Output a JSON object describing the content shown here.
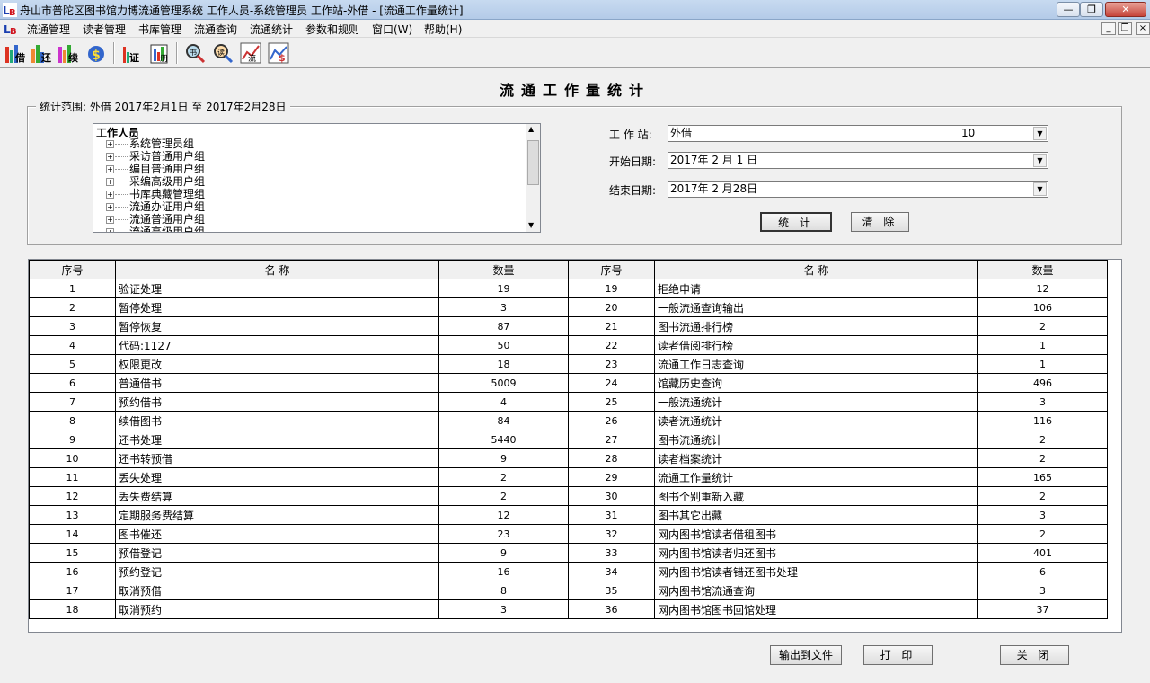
{
  "window": {
    "title": "舟山市普陀区图书馆力博流通管理系统 工作人员-系统管理员 工作站-外借 - [流通工作量统计]",
    "minimize": "—",
    "maximize": "❐",
    "close": "✕"
  },
  "menu": {
    "items": [
      "流通管理",
      "读者管理",
      "书库管理",
      "流通查询",
      "流通统计",
      "参数和规则",
      "窗口(W)",
      "帮助(H)"
    ]
  },
  "toolbar": {
    "buttons": [
      {
        "icon": "checkout-icon",
        "label": "借"
      },
      {
        "icon": "return-icon",
        "label": "还"
      },
      {
        "icon": "renew-icon",
        "label": "续"
      },
      {
        "icon": "fine-icon",
        "label": "$"
      },
      {
        "icon": "reader-icon",
        "label": "证"
      },
      {
        "icon": "report-icon",
        "label": "册"
      },
      {
        "icon": "search-book-icon",
        "label": "书"
      },
      {
        "icon": "search-reader-icon",
        "label": "读"
      },
      {
        "icon": "circulation-chart-icon",
        "label": "流"
      },
      {
        "icon": "fee-chart-icon",
        "label": "$"
      }
    ]
  },
  "form": {
    "title": "流通工作量统计",
    "range_caption": "统计范围:  外借  2017年2月1日  至  2017年2月28日",
    "tree_root": "工作人员",
    "tree_items": [
      "系统管理员组",
      "采访普通用户组",
      "编目普通用户组",
      "采编高级用户组",
      "书库典藏管理组",
      "流通办证用户组",
      "流通普通用户组",
      "流通高级用户组"
    ],
    "workstation_label": "工 作 站:",
    "workstation_value": "外借",
    "workstation_code": "10",
    "start_label": "开始日期:",
    "start_value": "2017年 2 月 1 日",
    "end_label": "结束日期:",
    "end_value": "2017年 2 月28日",
    "stat_button": "统 计",
    "clear_button": "清 除"
  },
  "grid": {
    "headers": [
      "序号",
      "名    称",
      "数量",
      "序号",
      "名    称",
      "数量"
    ],
    "rows": [
      {
        "s1": "1",
        "n1": "验证处理",
        "q1": "19",
        "s2": "19",
        "n2": "拒绝申请",
        "q2": "12"
      },
      {
        "s1": "2",
        "n1": "暂停处理",
        "q1": "3",
        "s2": "20",
        "n2": "一般流通查询输出",
        "q2": "106"
      },
      {
        "s1": "3",
        "n1": "暂停恢复",
        "q1": "87",
        "s2": "21",
        "n2": "图书流通排行榜",
        "q2": "2"
      },
      {
        "s1": "4",
        "n1": "代码:1127",
        "q1": "50",
        "s2": "22",
        "n2": "读者借阅排行榜",
        "q2": "1"
      },
      {
        "s1": "5",
        "n1": "权限更改",
        "q1": "18",
        "s2": "23",
        "n2": "流通工作日志查询",
        "q2": "1"
      },
      {
        "s1": "6",
        "n1": "普通借书",
        "q1": "5009",
        "s2": "24",
        "n2": "馆藏历史查询",
        "q2": "496"
      },
      {
        "s1": "7",
        "n1": "预约借书",
        "q1": "4",
        "s2": "25",
        "n2": "一般流通统计",
        "q2": "3"
      },
      {
        "s1": "8",
        "n1": "续借图书",
        "q1": "84",
        "s2": "26",
        "n2": "读者流通统计",
        "q2": "116"
      },
      {
        "s1": "9",
        "n1": "还书处理",
        "q1": "5440",
        "s2": "27",
        "n2": "图书流通统计",
        "q2": "2"
      },
      {
        "s1": "10",
        "n1": "还书转预借",
        "q1": "9",
        "s2": "28",
        "n2": "读者档案统计",
        "q2": "2"
      },
      {
        "s1": "11",
        "n1": "丢失处理",
        "q1": "2",
        "s2": "29",
        "n2": "流通工作量统计",
        "q2": "165"
      },
      {
        "s1": "12",
        "n1": "丢失费结算",
        "q1": "2",
        "s2": "30",
        "n2": "图书个别重新入藏",
        "q2": "2"
      },
      {
        "s1": "13",
        "n1": "定期服务费结算",
        "q1": "12",
        "s2": "31",
        "n2": "图书其它出藏",
        "q2": "3"
      },
      {
        "s1": "14",
        "n1": "图书催还",
        "q1": "23",
        "s2": "32",
        "n2": "网内图书馆读者借租图书",
        "q2": "2"
      },
      {
        "s1": "15",
        "n1": "预借登记",
        "q1": "9",
        "s2": "33",
        "n2": "网内图书馆读者归还图书",
        "q2": "401"
      },
      {
        "s1": "16",
        "n1": "预约登记",
        "q1": "16",
        "s2": "34",
        "n2": "网内图书馆读者错还图书处理",
        "q2": "6"
      },
      {
        "s1": "17",
        "n1": "取消预借",
        "q1": "8",
        "s2": "35",
        "n2": "网内图书馆流通查询",
        "q2": "3"
      },
      {
        "s1": "18",
        "n1": "取消预约",
        "q1": "3",
        "s2": "36",
        "n2": "网内图书馆图书回馆处理",
        "q2": "37"
      }
    ]
  },
  "footer": {
    "export_button": "输出到文件",
    "print_button": "打 印",
    "close_button": "关 闭"
  },
  "colors": {
    "titlebar": "#c7daf0",
    "window_bg": "#f0f0f0",
    "grid_bg": "#ffffff"
  }
}
